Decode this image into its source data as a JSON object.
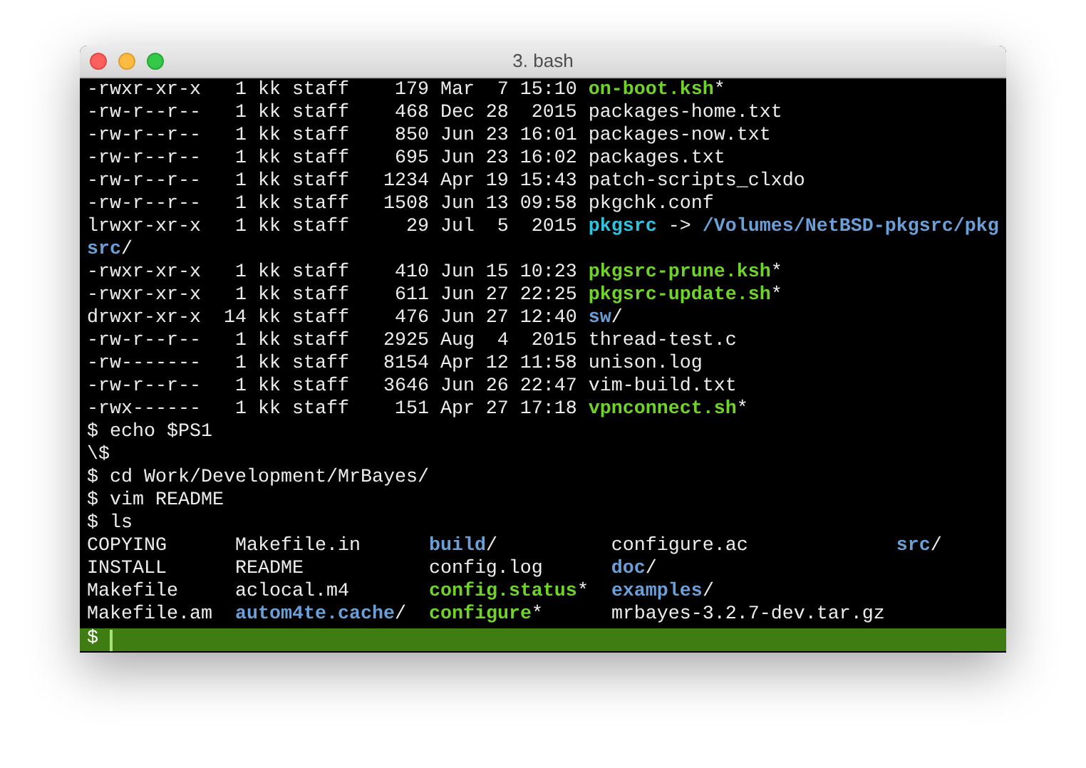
{
  "window": {
    "title": "3. bash"
  },
  "lines": [
    {
      "segments": [
        {
          "text": "-rwxr-xr-x   1 kk staff    179 Mar  7 15:10 ",
          "kind": "plain"
        },
        {
          "text": "on-boot.ksh",
          "kind": "exec"
        },
        {
          "text": "*",
          "kind": "plain"
        }
      ]
    },
    {
      "segments": [
        {
          "text": "-rw-r--r--   1 kk staff    468 Dec 28  2015 packages-home.txt",
          "kind": "plain"
        }
      ]
    },
    {
      "segments": [
        {
          "text": "-rw-r--r--   1 kk staff    850 Jun 23 16:01 packages-now.txt",
          "kind": "plain"
        }
      ]
    },
    {
      "segments": [
        {
          "text": "-rw-r--r--   1 kk staff    695 Jun 23 16:02 packages.txt",
          "kind": "plain"
        }
      ]
    },
    {
      "segments": [
        {
          "text": "-rw-r--r--   1 kk staff   1234 Apr 19 15:43 patch-scripts_clxdo",
          "kind": "plain"
        }
      ]
    },
    {
      "segments": [
        {
          "text": "-rw-r--r--   1 kk staff   1508 Jun 13 09:58 pkgchk.conf",
          "kind": "plain"
        }
      ]
    },
    {
      "segments": [
        {
          "text": "lrwxr-xr-x   1 kk staff     29 Jul  5  2015 ",
          "kind": "plain"
        },
        {
          "text": "pkgsrc",
          "kind": "link"
        },
        {
          "text": " -> ",
          "kind": "plain"
        },
        {
          "text": "/Volumes/NetBSD-pkgsrc/pkg",
          "kind": "dir"
        }
      ]
    },
    {
      "segments": [
        {
          "text": "src",
          "kind": "dir"
        },
        {
          "text": "/",
          "kind": "plain"
        }
      ]
    },
    {
      "segments": [
        {
          "text": "-rwxr-xr-x   1 kk staff    410 Jun 15 10:23 ",
          "kind": "plain"
        },
        {
          "text": "pkgsrc-prune.ksh",
          "kind": "exec"
        },
        {
          "text": "*",
          "kind": "plain"
        }
      ]
    },
    {
      "segments": [
        {
          "text": "-rwxr-xr-x   1 kk staff    611 Jun 27 22:25 ",
          "kind": "plain"
        },
        {
          "text": "pkgsrc-update.sh",
          "kind": "exec"
        },
        {
          "text": "*",
          "kind": "plain"
        }
      ]
    },
    {
      "segments": [
        {
          "text": "drwxr-xr-x  14 kk staff    476 Jun 27 12:40 ",
          "kind": "plain"
        },
        {
          "text": "sw",
          "kind": "dir"
        },
        {
          "text": "/",
          "kind": "plain"
        }
      ]
    },
    {
      "segments": [
        {
          "text": "-rw-r--r--   1 kk staff   2925 Aug  4  2015 thread-test.c",
          "kind": "plain"
        }
      ]
    },
    {
      "segments": [
        {
          "text": "-rw-------   1 kk staff   8154 Apr 12 11:58 unison.log",
          "kind": "plain"
        }
      ]
    },
    {
      "segments": [
        {
          "text": "-rw-r--r--   1 kk staff   3646 Jun 26 22:47 vim-build.txt",
          "kind": "plain"
        }
      ]
    },
    {
      "segments": [
        {
          "text": "-rwx------   1 kk staff    151 Apr 27 17:18 ",
          "kind": "plain"
        },
        {
          "text": "vpnconnect.sh",
          "kind": "exec"
        },
        {
          "text": "*",
          "kind": "plain"
        }
      ]
    },
    {
      "segments": [
        {
          "text": "$ echo $PS1",
          "kind": "plain"
        }
      ]
    },
    {
      "segments": [
        {
          "text": "\\$",
          "kind": "plain"
        }
      ]
    },
    {
      "segments": [
        {
          "text": "$ cd Work/Development/MrBayes/",
          "kind": "plain"
        }
      ]
    },
    {
      "segments": [
        {
          "text": "$ vim README",
          "kind": "plain"
        }
      ]
    },
    {
      "segments": [
        {
          "text": "$ ls",
          "kind": "plain"
        }
      ]
    },
    {
      "segments": [
        {
          "text": "COPYING      Makefile.in      ",
          "kind": "plain"
        },
        {
          "text": "build",
          "kind": "dir"
        },
        {
          "text": "/          configure.ac             ",
          "kind": "plain"
        },
        {
          "text": "src",
          "kind": "dir"
        },
        {
          "text": "/",
          "kind": "plain"
        }
      ]
    },
    {
      "segments": [
        {
          "text": "INSTALL      README           config.log      ",
          "kind": "plain"
        },
        {
          "text": "doc",
          "kind": "dir"
        },
        {
          "text": "/",
          "kind": "plain"
        }
      ]
    },
    {
      "segments": [
        {
          "text": "Makefile     aclocal.m4       ",
          "kind": "plain"
        },
        {
          "text": "config.status",
          "kind": "exec"
        },
        {
          "text": "*  ",
          "kind": "plain"
        },
        {
          "text": "examples",
          "kind": "dir"
        },
        {
          "text": "/",
          "kind": "plain"
        }
      ]
    },
    {
      "segments": [
        {
          "text": "Makefile.am  ",
          "kind": "plain"
        },
        {
          "text": "autom4te.cache",
          "kind": "dir"
        },
        {
          "text": "/  ",
          "kind": "plain"
        },
        {
          "text": "configure",
          "kind": "exec"
        },
        {
          "text": "*      mrbayes-3.2.7-dev.tar.gz",
          "kind": "plain"
        }
      ]
    }
  ],
  "prompt": {
    "text": "$"
  }
}
